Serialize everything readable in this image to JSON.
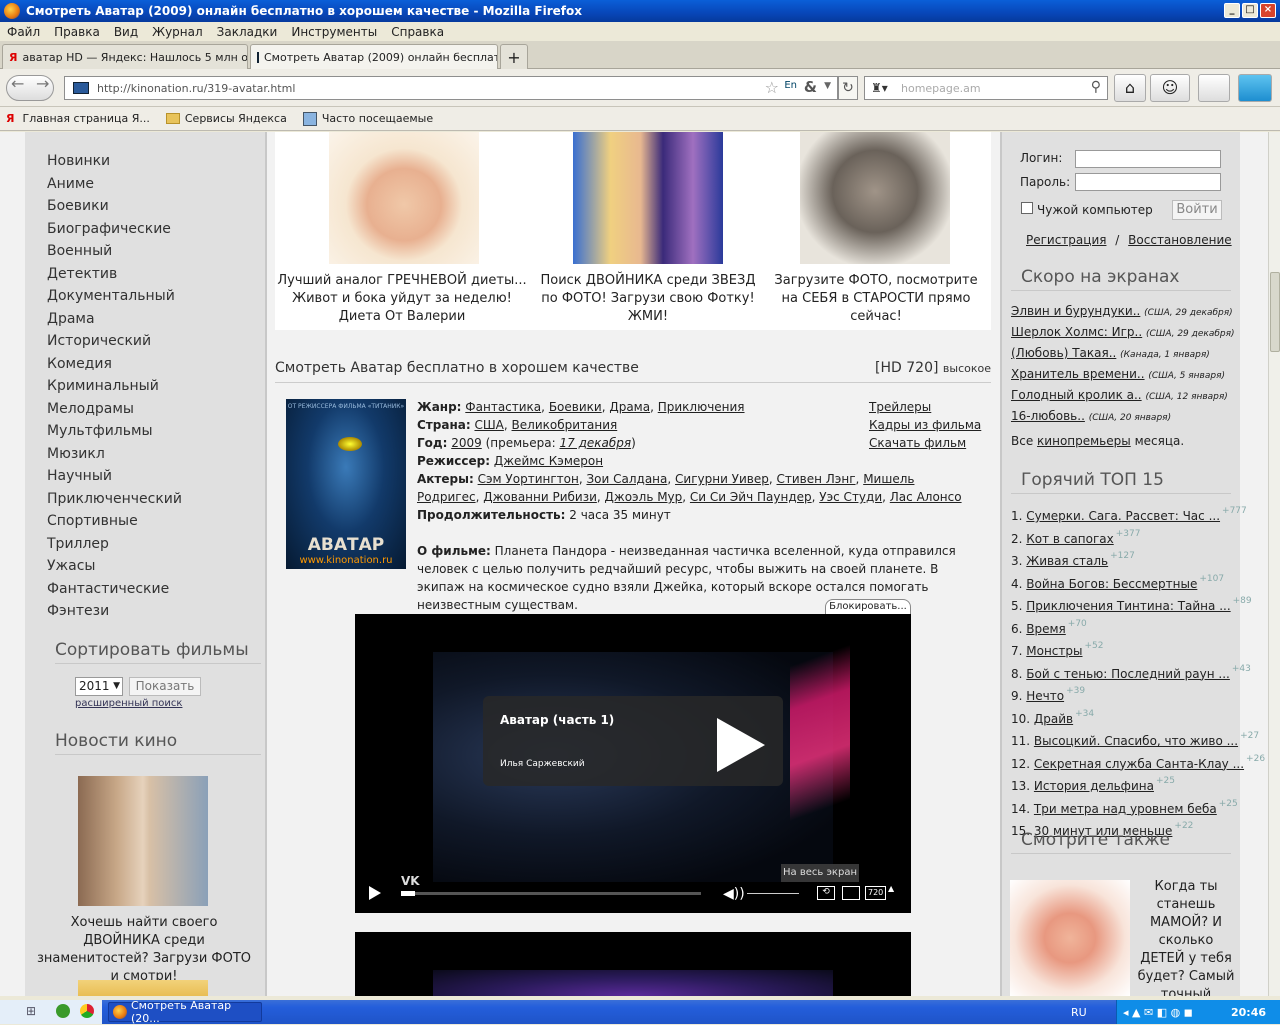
{
  "window": {
    "title": "Смотреть Аватар (2009) онлайн бесплатно в хорошем качестве - Mozilla Firefox",
    "min": "_",
    "max": "□",
    "close": "×"
  },
  "menu": [
    "Файл",
    "Правка",
    "Вид",
    "Журнал",
    "Закладки",
    "Инструменты",
    "Справка"
  ],
  "tabs": [
    {
      "label": "аватар HD — Яндекс: Нашлось 5 млн о..."
    },
    {
      "label": "Смотреть Аватар (2009) онлайн бесплат..."
    }
  ],
  "new_tab": "+",
  "address": {
    "url": "http://kinonation.ru/319-avatar.html"
  },
  "search": {
    "placeholder": "homepage.am"
  },
  "bookmarks": [
    "Главная страница Я...",
    "Сервисы Яндекса",
    "Часто посещаемые"
  ],
  "left": {
    "genres": [
      "Новинки",
      "Аниме",
      "Боевики",
      "Биографические",
      "Военный",
      "Детектив",
      "Документальный",
      "Драма",
      "Исторический",
      "Комедия",
      "Криминальный",
      "Мелодрамы",
      "Мультфильмы",
      "Мюзикл",
      "Научный",
      "Приключенческий",
      "Спортивные",
      "Триллер",
      "Ужасы",
      "Фантастические",
      "Фэнтези"
    ],
    "sort_heading": "Сортировать фильмы",
    "year_value": "2011",
    "show_button": "Показать",
    "advanced_search": "расширенный поиск",
    "news_heading": "Новости кино",
    "news_caption": "Хочешь найти своего ДВОЙНИКА среди знаменитостей? Загрузи ФОТО и смотри!"
  },
  "ads": [
    {
      "caption": "Лучший аналог ГРЕЧНЕВОЙ диеты... Живот и бока уйдут за неделю! Диета От Валерии"
    },
    {
      "caption": "Поиск ДВОЙНИКА среди ЗВЕЗД по ФОТО! Загрузи свою Фотку! ЖМИ!"
    },
    {
      "caption": "Загрузите ФОТО, посмотрите на СЕБЯ в СТАРОСТИ прямо сейчас!"
    }
  ],
  "movie": {
    "heading": "Смотреть Аватар бесплатно в хорошем качестве",
    "quality": "[HD 720]",
    "quality_note": "высокое",
    "poster_title": "АВАТАР",
    "poster_site": "www.kinonation.ru",
    "poster_tagline": "ОТ РЕЖИССЕРА ФИЛЬМА «ТИТАНИК»",
    "genre_label": "Жанр:",
    "genres": [
      "Фантастика",
      "Боевики",
      "Драма",
      "Приключения"
    ],
    "country_label": "Страна:",
    "countries": [
      "США",
      "Великобритания"
    ],
    "year_label": "Год:",
    "year": "2009",
    "premiere_prefix": "(премьера:",
    "premiere": "17 декабря",
    "premiere_suffix": ")",
    "director_label": "Режиссер:",
    "director": "Джеймс Кэмерон",
    "actors_label": "Актеры:",
    "actors": [
      "Сэм Уортингтон",
      "Зои Салдана",
      "Сигурни Уивер",
      "Стивен Лэнг",
      "Мишель Родригес",
      "Джованни Рибизи",
      "Джоэль Мур",
      "Си Си Эйч Паундер",
      "Уэс Студи",
      "Лас Алонсо"
    ],
    "duration_label": "Продолжительность:",
    "duration": "2 часа 35 минут",
    "about_label": "О фильме:",
    "about": "Планета Пандора - неизведанная частичка вселенной, куда отправился человек с целью получить редчайший ресурс, чтобы выжить на своей планете. В экипаж на космическое судно взяли Джейка, который вскоре остался помогать неизвестным существам.",
    "links": [
      "Трейлеры",
      "Кадры из фильма",
      "Скачать фильм"
    ]
  },
  "player": {
    "block_label": "Блокировать...",
    "title": "Аватар  (часть 1)",
    "author": "Илья Саржевский",
    "logo": "VK",
    "fullscreen_tip": "На весь экран",
    "quality": "720",
    "progress": 0.0
  },
  "right": {
    "login_label": "Логин:",
    "password_label": "Пароль:",
    "remember": "Чужой компьютер",
    "login_button": "Войти",
    "register": "Регистрация",
    "sep": "/",
    "restore": "Восстановление",
    "coming_heading": "Скоро на экранах",
    "coming": [
      {
        "title": "Элвин и бурундуки..",
        "meta": "(США, 29 декабря)"
      },
      {
        "title": "Шерлок Холмс: Игр..",
        "meta": "(США, 29 декабря)"
      },
      {
        "title": "(Любовь) Такая..",
        "meta": "(Канада, 1 января)"
      },
      {
        "title": "Хранитель времени..",
        "meta": "(США, 5 января)"
      },
      {
        "title": "Голодный кролик а..",
        "meta": "(США, 12 января)"
      },
      {
        "title": "16-любовь..",
        "meta": "(США, 20 января)"
      }
    ],
    "all_prefix": "Все",
    "all_link": "кинопремьеры",
    "all_suffix": "месяца.",
    "top_heading": "Горячий ТОП 15",
    "top": [
      {
        "n": "1.",
        "title": "Сумерки. Сага. Рассвет: Час ...",
        "delta": "+777"
      },
      {
        "n": "2.",
        "title": "Кот в сапогах",
        "delta": "+377"
      },
      {
        "n": "3.",
        "title": "Живая сталь",
        "delta": "+127"
      },
      {
        "n": "4.",
        "title": "Война Богов: Бессмертные",
        "delta": "+107"
      },
      {
        "n": "5.",
        "title": "Приключения Тинтина: Тайна ...",
        "delta": "+89"
      },
      {
        "n": "6.",
        "title": "Время",
        "delta": "+70"
      },
      {
        "n": "7.",
        "title": "Монстры",
        "delta": "+52"
      },
      {
        "n": "8.",
        "title": "Бой с тенью: Последний раун ...",
        "delta": "+43"
      },
      {
        "n": "9.",
        "title": "Нечто",
        "delta": "+39"
      },
      {
        "n": "10.",
        "title": "Драйв",
        "delta": "+34"
      },
      {
        "n": "11.",
        "title": "Высоцкий. Спасибо, что живо ...",
        "delta": "+27"
      },
      {
        "n": "12.",
        "title": "Секретная служба Санта-Клау ...",
        "delta": "+26"
      },
      {
        "n": "13.",
        "title": "История дельфина",
        "delta": "+25"
      },
      {
        "n": "14.",
        "title": "Три метра над уровнем беба",
        "delta": "+25"
      },
      {
        "n": "15.",
        "title": "30 минут или меньше",
        "delta": "+22"
      }
    ],
    "see_also_heading": "Смотрите также",
    "see_also_caption": "Когда ты станешь МАМОЙ? И сколько ДЕТЕЙ у тебя будет? Самый точный онлайн тест."
  },
  "taskbar": {
    "item": "Смотреть Аватар (20...",
    "lang": "RU",
    "clock": "20:46"
  }
}
